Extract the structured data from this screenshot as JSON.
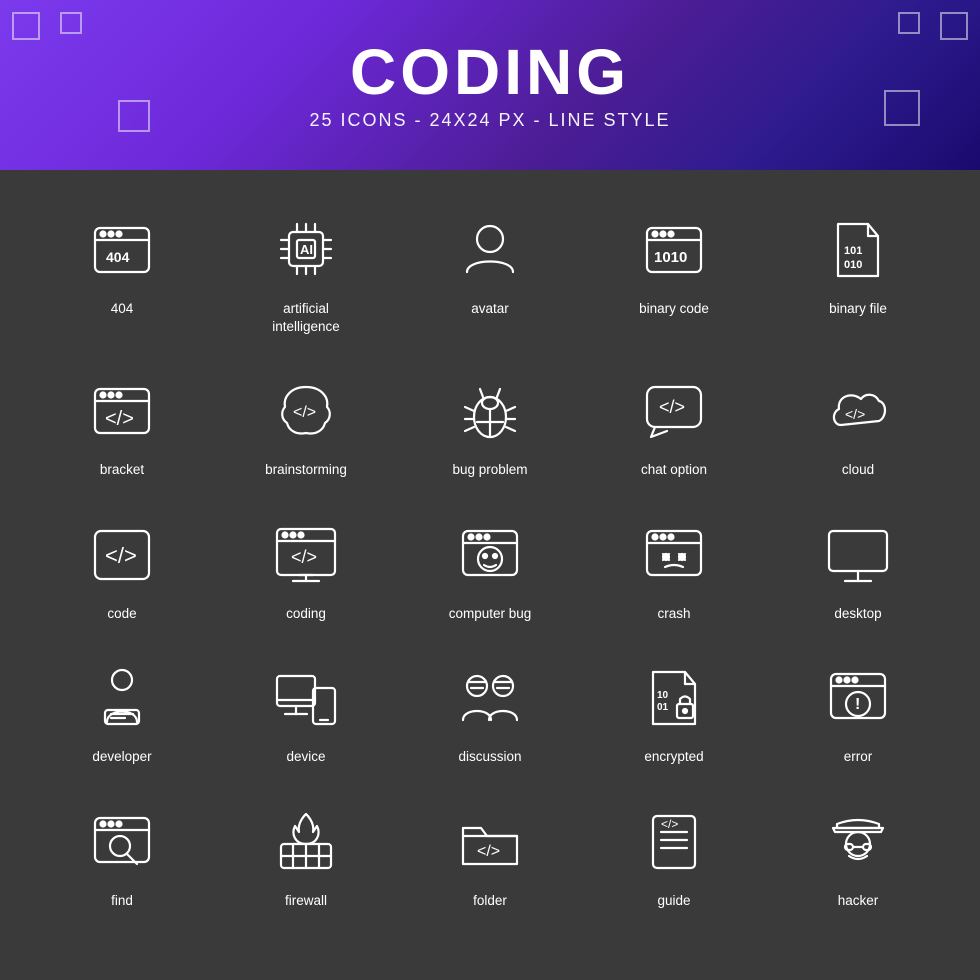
{
  "header": {
    "title": "CODING",
    "subtitle": "25 ICONS - 24X24 PX - LINE STYLE"
  },
  "icons": [
    {
      "id": "404",
      "label": "404"
    },
    {
      "id": "artificial-intelligence",
      "label": "artificial\nintelligence"
    },
    {
      "id": "avatar",
      "label": "avatar"
    },
    {
      "id": "binary-code",
      "label": "binary code"
    },
    {
      "id": "binary-file",
      "label": "binary file"
    },
    {
      "id": "bracket",
      "label": "bracket"
    },
    {
      "id": "brainstorming",
      "label": "brainstorming"
    },
    {
      "id": "bug-problem",
      "label": "bug problem"
    },
    {
      "id": "chat-option",
      "label": "chat option"
    },
    {
      "id": "cloud",
      "label": "cloud"
    },
    {
      "id": "code",
      "label": "code"
    },
    {
      "id": "coding",
      "label": "coding"
    },
    {
      "id": "computer-bug",
      "label": "computer bug"
    },
    {
      "id": "crash",
      "label": "crash"
    },
    {
      "id": "desktop",
      "label": "desktop"
    },
    {
      "id": "developer",
      "label": "developer"
    },
    {
      "id": "device",
      "label": "device"
    },
    {
      "id": "discussion",
      "label": "discussion"
    },
    {
      "id": "encrypted",
      "label": "encrypted"
    },
    {
      "id": "error",
      "label": "error"
    },
    {
      "id": "find",
      "label": "find"
    },
    {
      "id": "firewall",
      "label": "firewall"
    },
    {
      "id": "folder",
      "label": "folder"
    },
    {
      "id": "guide",
      "label": "guide"
    },
    {
      "id": "hacker",
      "label": "hacker"
    }
  ]
}
